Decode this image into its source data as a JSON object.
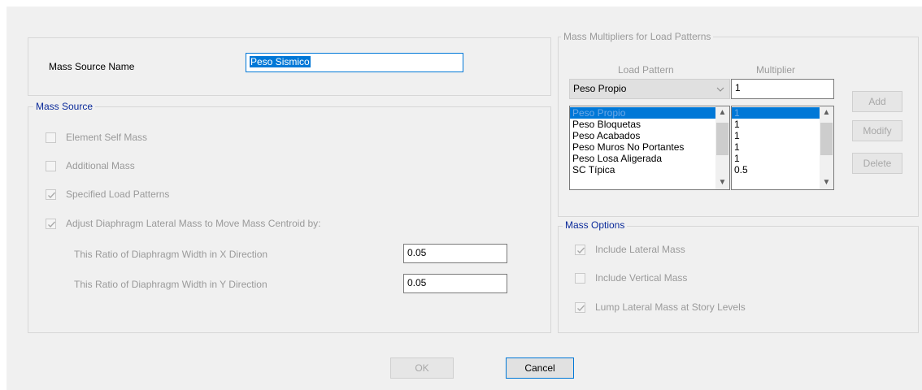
{
  "mass_source_name": {
    "label": "Mass Source Name",
    "value": "Peso Sismico"
  },
  "mass_source": {
    "legend": "Mass Source",
    "element_self_mass": {
      "label": "Element Self Mass",
      "checked": false
    },
    "additional_mass": {
      "label": "Additional Mass",
      "checked": false
    },
    "specified_load_patterns": {
      "label": "Specified Load Patterns",
      "checked": true
    },
    "adjust_diaphragm": {
      "label": "Adjust Diaphragm Lateral Mass to Move Mass Centroid by:",
      "checked": true
    },
    "ratio_x": {
      "label": "This Ratio of Diaphragm Width in X Direction",
      "value": "0.05"
    },
    "ratio_y": {
      "label": "This Ratio of Diaphragm Width in Y Direction",
      "value": "0.05"
    }
  },
  "multipliers": {
    "legend": "Mass Multipliers for Load Patterns",
    "col_load_pattern": "Load Pattern",
    "col_multiplier": "Multiplier",
    "load_pattern_selected": "Peso Propio",
    "multiplier_value": "1",
    "patterns": [
      "Peso Propio",
      "Peso Bloquetas",
      "Peso Acabados",
      "Peso Muros No Portantes",
      "Peso Losa Aligerada",
      "SC Típica"
    ],
    "values": [
      "1",
      "1",
      "1",
      "1",
      "1",
      "0.5"
    ],
    "add_label": "Add",
    "modify_label": "Modify",
    "delete_label": "Delete"
  },
  "mass_options": {
    "legend": "Mass Options",
    "include_lateral": {
      "label": "Include Lateral Mass",
      "checked": true
    },
    "include_vertical": {
      "label": "Include Vertical Mass",
      "checked": false
    },
    "lump_lateral": {
      "label": "Lump Lateral Mass at Story Levels",
      "checked": true
    }
  },
  "buttons": {
    "ok_label": "OK",
    "cancel_label": "Cancel"
  }
}
